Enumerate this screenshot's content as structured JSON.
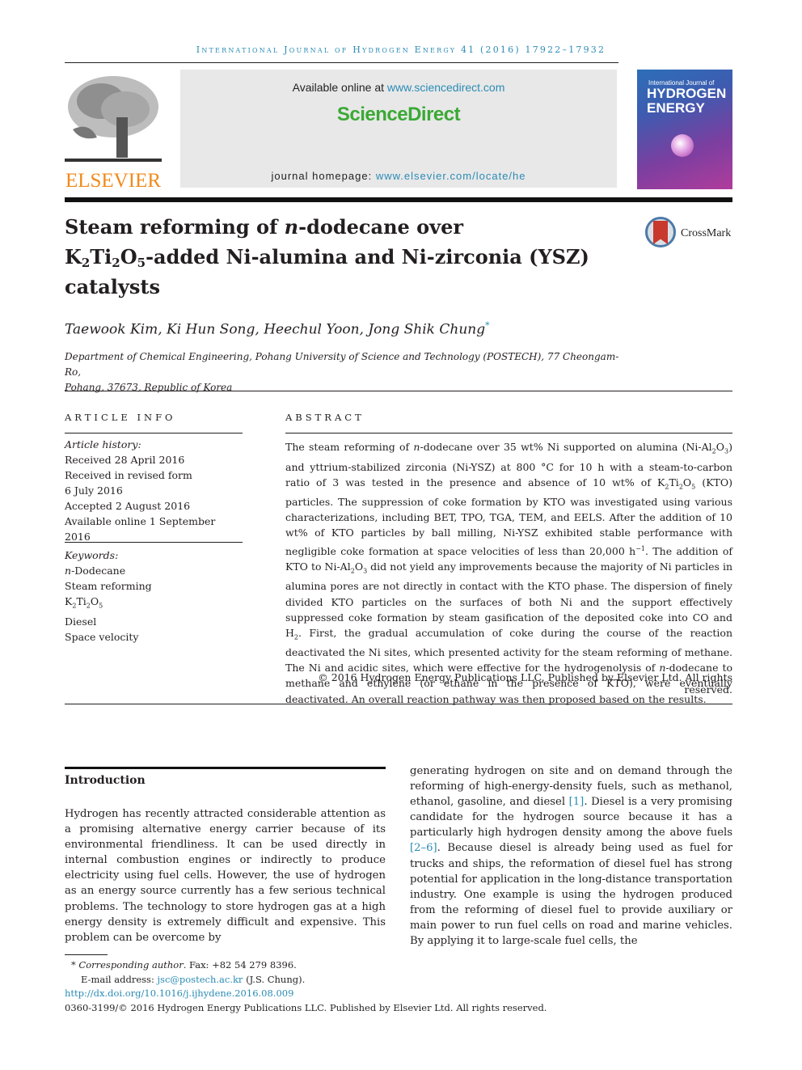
{
  "running_head": "International Journal of Hydrogen Energy 41 (2016) 17922–17932",
  "publisher": {
    "name": "ELSEVIER",
    "logo_icon": "elsevier-tree-icon",
    "brand_color": "#f08a1c"
  },
  "banner": {
    "available_prefix": "Available online at ",
    "available_link": "www.sciencedirect.com",
    "brand": "ScienceDirect",
    "brand_color": "#3aa935",
    "homepage_prefix": "journal homepage: ",
    "homepage_link": "www.elsevier.com/locate/he"
  },
  "cover": {
    "line1": "International Journal of",
    "line2": "HYDROGEN",
    "line3": "ENERGY"
  },
  "article": {
    "title_line1_a": "Steam reforming of ",
    "title_line1_italic": "n",
    "title_line1_b": "-dodecane over",
    "title_line2_a": "K",
    "title_line2_sub1": "2",
    "title_line2_b": "Ti",
    "title_line2_sub2": "2",
    "title_line2_c": "O",
    "title_line2_sub3": "5",
    "title_line2_d": "-added Ni-alumina and Ni-zirconia (YSZ)",
    "title_line3": "catalysts",
    "crossmark_label": "CrossMark",
    "authors": "Taewook Kim, Ki Hun Song, Heechul Yoon, Jong Shik Chung",
    "corresponding_mark": "*",
    "affiliation_line1": "Department of Chemical Engineering, Pohang University of Science and Technology (POSTECH), 77 Cheongam-Ro,",
    "affiliation_line2": "Pohang, 37673, Republic of Korea"
  },
  "article_info": {
    "heading": "ARTICLE INFO",
    "history_label": "Article history:",
    "history": [
      "Received 28 April 2016",
      "Received in revised form",
      "6 July 2016",
      "Accepted 2 August 2016",
      "Available online 1 September 2016"
    ],
    "keywords_label": "Keywords:",
    "keywords": [
      "n-Dodecane",
      "Steam reforming",
      "K2Ti2O5",
      "Diesel",
      "Space velocity"
    ]
  },
  "abstract": {
    "heading": "ABSTRACT",
    "p1": "The steam reforming of ",
    "p1_italic": "n",
    "p2": "-dodecane over 35 wt% Ni supported on alumina (Ni-Al",
    "p3": "O",
    "p4": ") and yttrium-stabilized zirconia (Ni-YSZ) at 800 °C for 10 h with a steam-to-carbon ratio of 3 was tested in the presence and absence of 10 wt% of K",
    "p5": "Ti",
    "p6": "O",
    "p7": " (KTO) particles. The suppression of coke formation by KTO was investigated using various characterizations, including BET, TPO, TGA, TEM, and EELS. After the addition of 10 wt% of KTO particles by ball milling, Ni-YSZ exhibited stable performance with negligible coke formation at space velocities of less than 20,000 h",
    "p7_sup": "−1",
    "p8": ". The addition of KTO to Ni-Al",
    "p9": "O",
    "p10": " did not yield any improvements because the majority of Ni particles in alumina pores are not directly in contact with the KTO phase. The dispersion of finely divided KTO particles on the surfaces of both Ni and the support effectively suppressed coke formation by steam gasification of the deposited coke into CO and H",
    "p11": ". First, the gradual accumulation of coke during the course of the reaction deactivated the Ni sites, which presented activity for the steam reforming of methane. The Ni and acidic sites, which were effective for the hydrogenolysis of ",
    "p11_italic": "n",
    "p12": "-dodecane to methane and ethylene (or ethane in the presence of KTO), were eventually deactivated. An overall reaction pathway was then proposed based on the results.",
    "copyright": "© 2016 Hydrogen Energy Publications LLC. Published by Elsevier Ltd. All rights reserved."
  },
  "introduction": {
    "heading": "Introduction",
    "left_col": "Hydrogen has recently attracted considerable attention as a promising alternative energy carrier because of its environmental friendliness. It can be used directly in internal combustion engines or indirectly to produce electricity using fuel cells. However, the use of hydrogen as an energy source currently has a few serious technical problems. The technology to store hydrogen gas at a high energy density is extremely difficult and expensive. This problem can be overcome by",
    "right_a": "generating hydrogen on site and on demand through the reforming of high-energy-density fuels, such as methanol, ethanol, gasoline, and diesel ",
    "ref1": "[1]",
    "right_b": ". Diesel is a very promising candidate for the hydrogen source because it has a particularly high hydrogen density among the above fuels ",
    "ref2": "[2–6]",
    "right_c": ". Because diesel is already being used as fuel for trucks and ships, the reformation of diesel fuel has strong potential for application in the long-distance transportation industry. One example is using the hydrogen produced from the reforming of diesel fuel to provide auxiliary or main power to run fuel cells on road and marine vehicles. By applying it to large-scale fuel cells, the"
  },
  "footnotes": {
    "corr_star": "* ",
    "corr_label": "Corresponding author",
    "corr_rest": ". Fax: +82 54 279 8396.",
    "email_label": "E-mail address: ",
    "email": "jsc@postech.ac.kr",
    "email_suffix": " (J.S. Chung).",
    "doi": "http://dx.doi.org/10.1016/j.ijhydene.2016.08.009",
    "issn_line": "0360-3199/© 2016 Hydrogen Energy Publications LLC. Published by Elsevier Ltd. All rights reserved."
  }
}
